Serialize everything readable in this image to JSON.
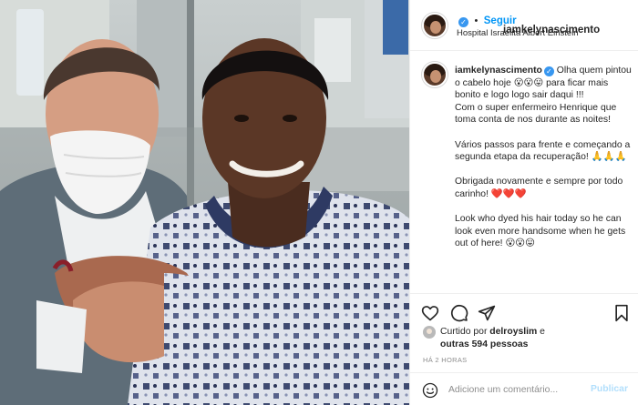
{
  "post": {
    "username": "iamkelynascimento",
    "verified": true,
    "follow_label": "Seguir",
    "separator": "•",
    "location": "Hospital Israelita Albert Einstein"
  },
  "caption": {
    "username": "iamkelynascimento",
    "text": "Olha quem pintou o cabelo hoje 😮😮😛 para ficar mais bonito e logo logo sair daqui !!!\nCom o super enfermeiro Henrique que toma conta de nos durante as noites!\n\nVários passos para frente e começando a segunda etapa da recuperação! 🙏🙏🙏\n\nObrigada novamente e sempre por todo carinho! ❤️❤️❤️\n\nLook who dyed his hair today so he can look even more handsome when he gets out of here! 😮😮😛"
  },
  "actions": {
    "like_icon": "heart-icon",
    "comment_icon": "comment-icon",
    "share_icon": "share-icon",
    "save_icon": "bookmark-icon"
  },
  "likes": {
    "prefix": "Curtido por",
    "user": "delroyslim",
    "connector": "e",
    "others": "outras 594 pessoas"
  },
  "timestamp": "HÁ 2 HORAS",
  "comment": {
    "placeholder": "Adicione um comentário...",
    "publish_label": "Publicar",
    "emoji_icon": "emoji-icon"
  },
  "colors": {
    "accent": "#0095f6",
    "publish_disabled": "#b2dffc",
    "verified": "#3897f0",
    "text": "#262626",
    "muted": "#8e8e8e",
    "border": "#efefef"
  }
}
